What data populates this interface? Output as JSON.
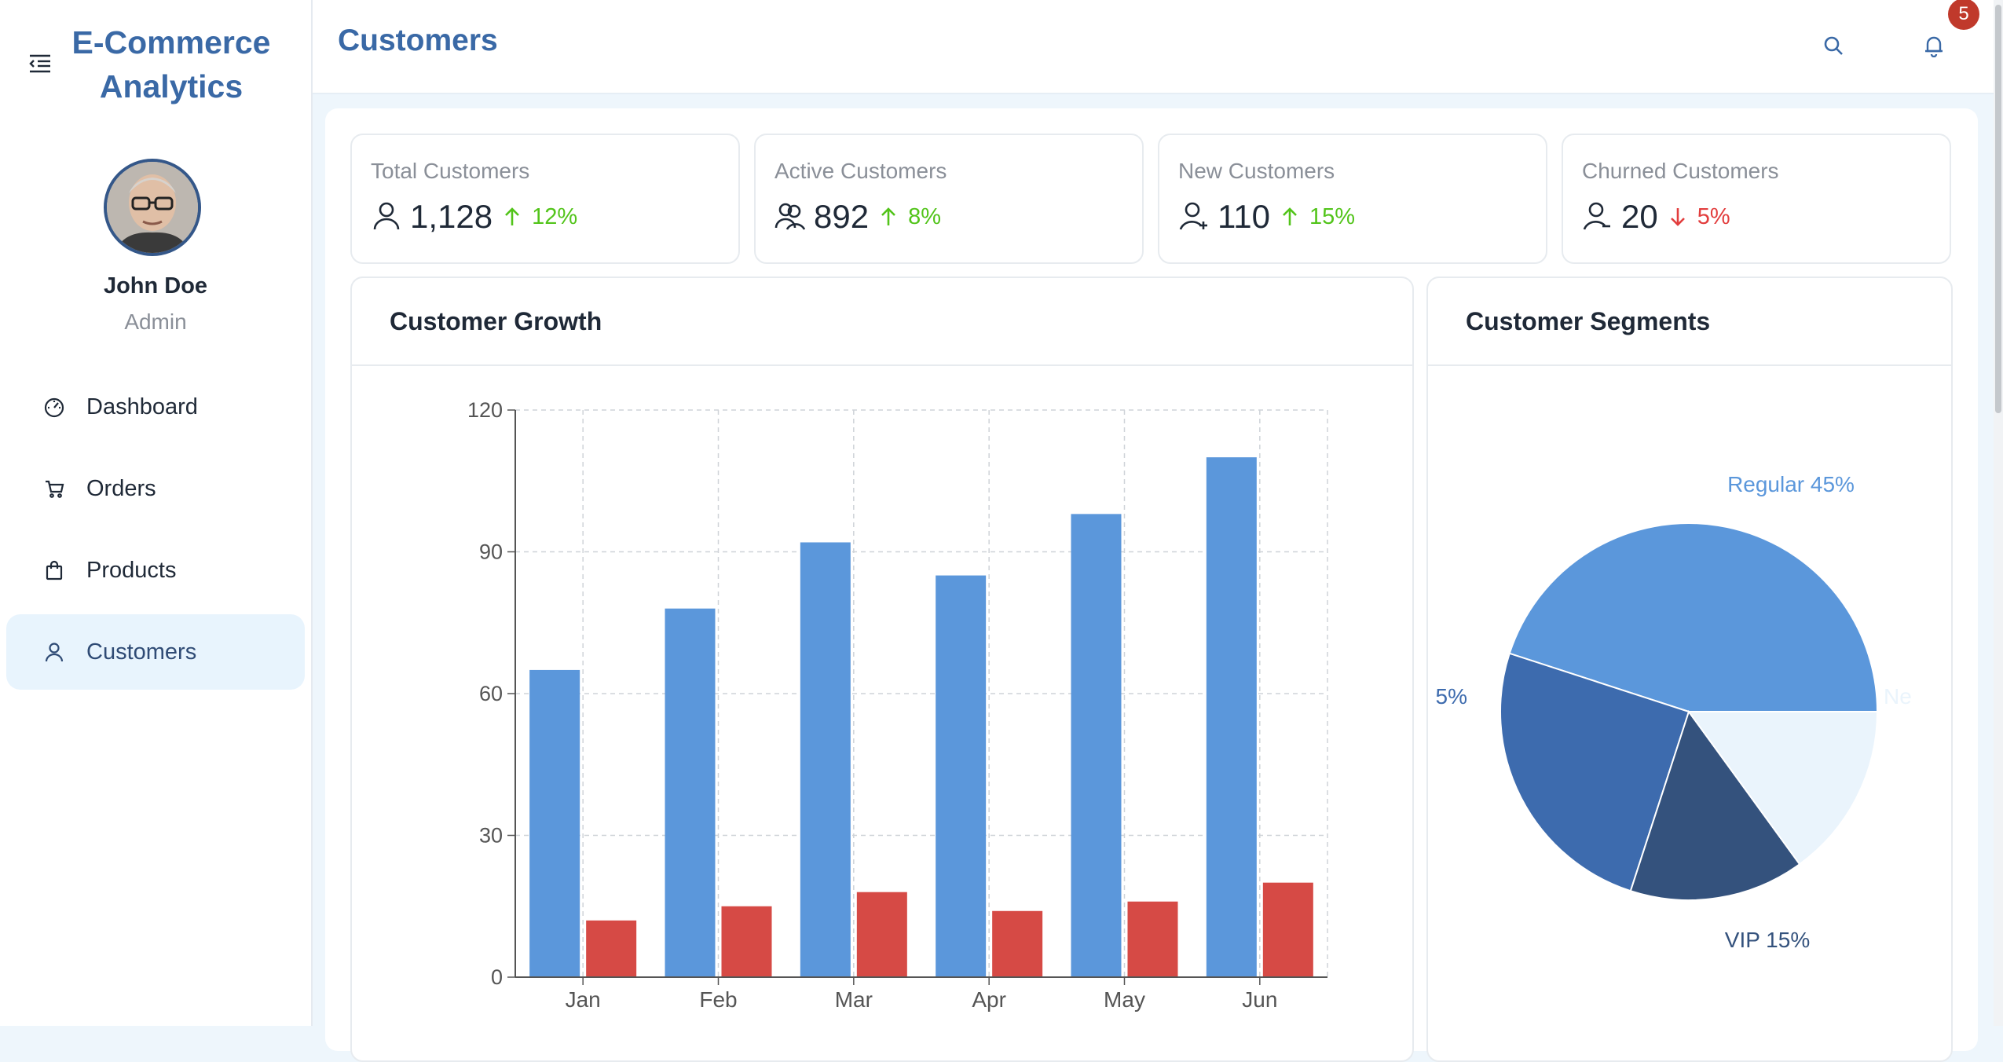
{
  "app": {
    "brand_line1": "E-Commerce",
    "brand_line2": "Analytics"
  },
  "user": {
    "name": "John Doe",
    "role": "Admin"
  },
  "nav": [
    {
      "label": "Dashboard",
      "icon": "dashboard-icon",
      "active": false
    },
    {
      "label": "Orders",
      "icon": "cart-icon",
      "active": false
    },
    {
      "label": "Products",
      "icon": "shopping-bag-icon",
      "active": false
    },
    {
      "label": "Customers",
      "icon": "user-icon",
      "active": true
    }
  ],
  "header": {
    "title": "Customers",
    "notification_count": "5"
  },
  "stats": [
    {
      "label": "Total Customers",
      "value": "1,128",
      "trend": "12%",
      "direction": "up",
      "icon": "user-icon"
    },
    {
      "label": "Active Customers",
      "value": "892",
      "trend": "8%",
      "direction": "up",
      "icon": "team-icon"
    },
    {
      "label": "New Customers",
      "value": "110",
      "trend": "15%",
      "direction": "up",
      "icon": "user-add-icon"
    },
    {
      "label": "Churned Customers",
      "value": "20",
      "trend": "5%",
      "direction": "down",
      "icon": "user-delete-icon"
    }
  ],
  "colors": {
    "accent": "#3a69a6",
    "up": "#52c41a",
    "down": "#e23d3d",
    "bar_blue": "#5b97db",
    "bar_red": "#d64a45"
  },
  "cards": {
    "growth_title": "Customer Growth",
    "segments_title": "Customer Segments"
  },
  "chart_data": [
    {
      "type": "bar",
      "categories": [
        "Jan",
        "Feb",
        "Mar",
        "Apr",
        "May",
        "Jun"
      ],
      "series": [
        {
          "values": [
            65,
            78,
            92,
            85,
            98,
            110
          ],
          "color": "#5b97db"
        },
        {
          "values": [
            12,
            15,
            18,
            14,
            16,
            20
          ],
          "color": "#d64a45"
        }
      ],
      "yticks": [
        "0",
        "30",
        "60",
        "90",
        "120"
      ],
      "ylim": [
        0,
        120
      ],
      "grid": true
    },
    {
      "type": "pie",
      "slices": [
        {
          "label": "Regular 45%",
          "value": 45,
          "color": "#5b97db"
        },
        {
          "label": "5%",
          "value": 25,
          "color": "#3d6bae"
        },
        {
          "label": "VIP 15%",
          "value": 15,
          "color": "#34527d"
        },
        {
          "label": "Ne",
          "value": 15,
          "color": "#eaf4fc"
        }
      ]
    }
  ]
}
